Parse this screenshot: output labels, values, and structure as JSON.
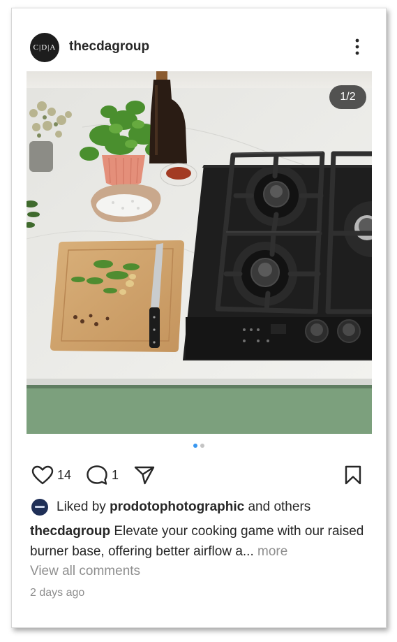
{
  "post": {
    "username": "thecdagroup",
    "avatar_text": "C|D|A",
    "image_counter": "1/2",
    "carousel": {
      "total": 2,
      "active_index": 0
    },
    "likes_count": "14",
    "comments_count": "1",
    "liked_by": {
      "prefix": "Liked by",
      "user": "prodotophotographic",
      "suffix": "and others"
    },
    "caption": {
      "user": "thecdagroup",
      "text": "Elevate your cooking game with our raised burner base, offering better airflow a...",
      "more": "more"
    },
    "view_comments": "View all comments",
    "timestamp": "2 days ago"
  },
  "icons": [
    "more-vertical-icon",
    "heart-icon",
    "comment-icon",
    "share-icon",
    "bookmark-icon"
  ],
  "colors": {
    "accent_dot": "#3897f0",
    "muted_text": "#8e8e8e",
    "cabinet_green": "#7ca07d",
    "hob_black": "#1e1e1e"
  }
}
